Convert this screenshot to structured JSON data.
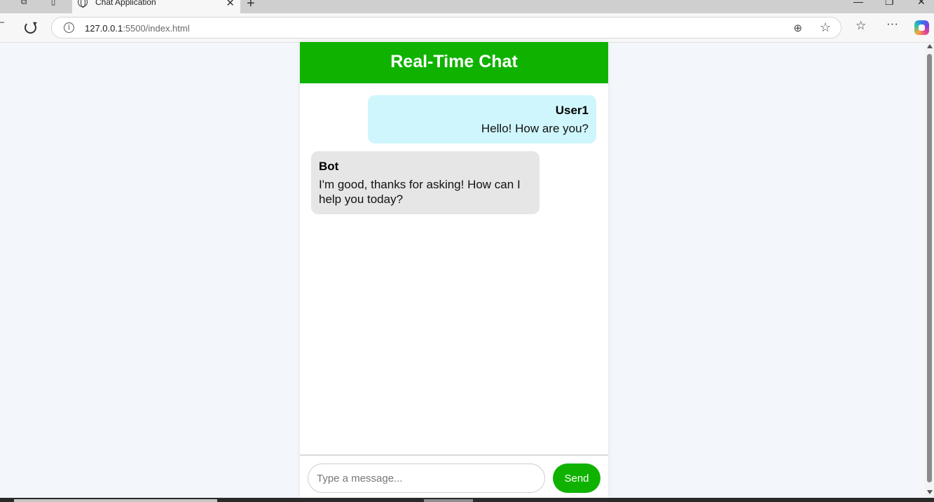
{
  "browser": {
    "tab_title": "Chat Application",
    "url_host": "127.0.0.1",
    "url_path": ":5500/index.html"
  },
  "chat": {
    "header_title": "Real-Time Chat",
    "messages": [
      {
        "sender": "User1",
        "text": "Hello! How are you?",
        "side": "right",
        "bubble_color": "#cff6fc"
      },
      {
        "sender": "Bot",
        "text": "I'm good, thanks for asking! How can I help you today?",
        "side": "left",
        "bubble_color": "#e6e6e6"
      }
    ],
    "input_placeholder": "Type a message...",
    "input_value": "",
    "send_label": "Send"
  },
  "colors": {
    "accent": "#10b200",
    "page_background": "#f3f6fb"
  }
}
